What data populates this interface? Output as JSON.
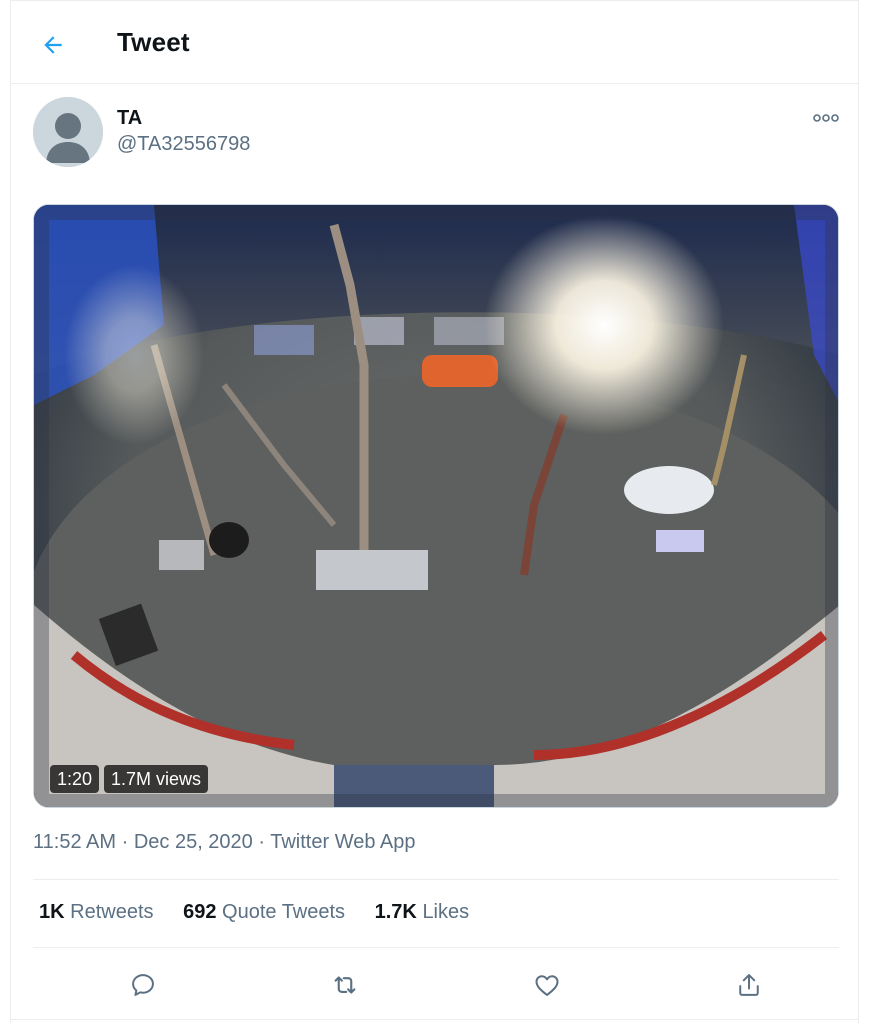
{
  "header": {
    "title": "Tweet",
    "back_icon": "arrow-left-icon"
  },
  "author": {
    "display_name": "TA",
    "handle": "@TA32556798",
    "avatar_icon": "default-avatar-icon"
  },
  "more_icon": "more-dots-icon",
  "media": {
    "type": "video",
    "duration": "1:20",
    "views": "1.7M views"
  },
  "meta": {
    "time": "11:52 AM",
    "date": "Dec 25, 2020",
    "separator": "·",
    "source": "Twitter Web App"
  },
  "stats": {
    "retweets_count": "1K",
    "retweets_label": "Retweets",
    "quotes_count": "692",
    "quotes_label": "Quote Tweets",
    "likes_count": "1.7K",
    "likes_label": "Likes"
  },
  "actions": [
    {
      "icon": "reply-icon"
    },
    {
      "icon": "retweet-icon"
    },
    {
      "icon": "like-heart-icon"
    },
    {
      "icon": "share-icon"
    }
  ],
  "colors": {
    "accent": "#1da1f2",
    "text_primary": "#0f1419",
    "text_secondary": "#5b7083",
    "border": "#ebeef0"
  }
}
